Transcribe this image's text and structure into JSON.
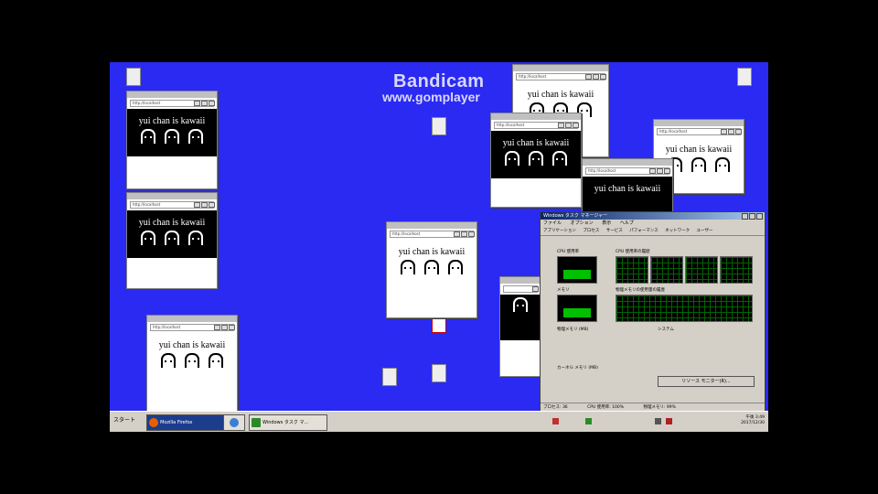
{
  "watermark": {
    "line1": "Bandicam",
    "line2": "www.gomplayer"
  },
  "popup": {
    "address": "http://localhost",
    "message": "yui chan is kawaii"
  },
  "task_manager": {
    "title": "Windows タスク マネージャー",
    "menu": [
      "ファイル",
      "オプション",
      "表示",
      "ヘルプ"
    ],
    "tabs": [
      "アプリケーション",
      "プロセス",
      "サービス",
      "パフォーマンス",
      "ネットワーク",
      "ユーザー"
    ],
    "cpu_usage_label": "CPU 使用率",
    "cpu_history_label": "CPU 使用率の履歴",
    "memory_label": "メモリ",
    "memory_history_label": "物理メモリの使用量の履歴",
    "cpu_value": "100 %",
    "physical_memory_label": "物理メモリ (MB)",
    "system_label": "システム",
    "kernel_memory_label": "カーネル メモリ (MB)",
    "end_button": "リソース モニター(R)...",
    "status_processes": "プロセス: 36",
    "status_cpu": "CPU 使用率: 100%",
    "status_memory": "物理メモリ: 99%"
  },
  "taskbar": {
    "start_label": "スタート",
    "buttons": [
      "Mozilla Firefox",
      "Windows タスク マ..."
    ],
    "clock_time": "午後 3:49",
    "clock_date": "2017/12/30"
  },
  "colors": {
    "desktop": "#2a2af2",
    "meter_green": "#00c000"
  }
}
